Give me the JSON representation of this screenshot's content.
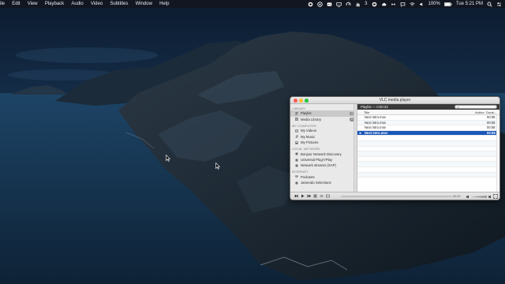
{
  "menubar": {
    "items": [
      "ile",
      "Edit",
      "View",
      "Playback",
      "Audio",
      "Video",
      "Subtitles",
      "Window",
      "Help"
    ],
    "status": {
      "count": "3",
      "battery": "100%",
      "clock": "Tue 5:21 PM"
    }
  },
  "vlc": {
    "title": "VLC media player",
    "sidebar": {
      "sections": [
        {
          "label": "LIBRARY",
          "items": [
            {
              "label": "Playlist",
              "icon": "playlist-icon",
              "badge": "4",
              "selected": true
            },
            {
              "label": "Media Library",
              "icon": "library-icon",
              "badge": "0",
              "selected": false
            }
          ]
        },
        {
          "label": "MY COMPUTER",
          "items": [
            {
              "label": "My Videos",
              "icon": "video-icon"
            },
            {
              "label": "My Music",
              "icon": "music-icon"
            },
            {
              "label": "My Pictures",
              "icon": "picture-icon"
            }
          ]
        },
        {
          "label": "LOCAL NETWORK",
          "items": [
            {
              "label": "Bonjour Network Discovery",
              "icon": "network-icon"
            },
            {
              "label": "Universal Plug'n'Play",
              "icon": "network-icon"
            },
            {
              "label": "Network streams (SAP)",
              "icon": "network-icon"
            }
          ]
        },
        {
          "label": "INTERNET",
          "items": [
            {
              "label": "Podcasts",
              "icon": "podcast-icon"
            },
            {
              "label": "Jamendo Selections",
              "icon": "network-icon"
            }
          ]
        }
      ]
    },
    "playlist": {
      "header": "Playlist — 0:00:33",
      "search_placeholder": "",
      "columns": {
        "title": "Title",
        "author": "Author",
        "duration": "Durat..."
      },
      "rows": [
        {
          "title": "Next intro.mov",
          "author": "",
          "duration": "00:08",
          "active": false
        },
        {
          "title": "Next intro.mov",
          "author": "",
          "duration": "00:08",
          "active": false
        },
        {
          "title": "Next intro.m4v",
          "author": "",
          "duration": "00:08",
          "active": false
        },
        {
          "title": "Next intro.mov",
          "author": "",
          "duration": "00:08",
          "active": true
        }
      ]
    },
    "controls": {
      "time": "00:00"
    }
  },
  "colors": {
    "selection": "#1a57b8",
    "close": "#fe5f57",
    "minimize": "#febc2e",
    "maximize": "#28c840"
  }
}
